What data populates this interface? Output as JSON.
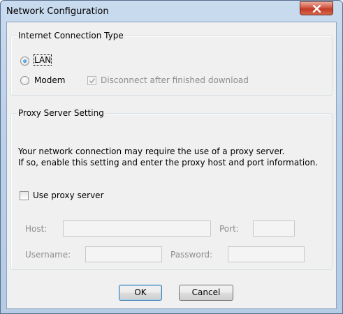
{
  "window": {
    "title": "Network Configuration",
    "close_glyph": "x-icon"
  },
  "connection_group": {
    "title": "Internet Connection Type",
    "lan_label": "LAN",
    "lan_selected": true,
    "modem_label": "Modem",
    "disconnect_label": "Disconnect after finished download",
    "disconnect_checked": true,
    "disconnect_enabled": false
  },
  "proxy_group": {
    "title": "Proxy Server Setting",
    "description_line1": "Your network connection may require the use of a proxy server.",
    "description_line2": "If so, enable this setting and enter the proxy host and port information.",
    "use_proxy_label": "Use proxy server",
    "use_proxy_checked": false,
    "host_label": "Host:",
    "host_value": "",
    "port_label": "Port:",
    "port_value": "",
    "username_label": "Username:",
    "username_value": "",
    "password_label": "Password:",
    "password_value": ""
  },
  "buttons": {
    "ok_label": "OK",
    "cancel_label": "Cancel"
  }
}
